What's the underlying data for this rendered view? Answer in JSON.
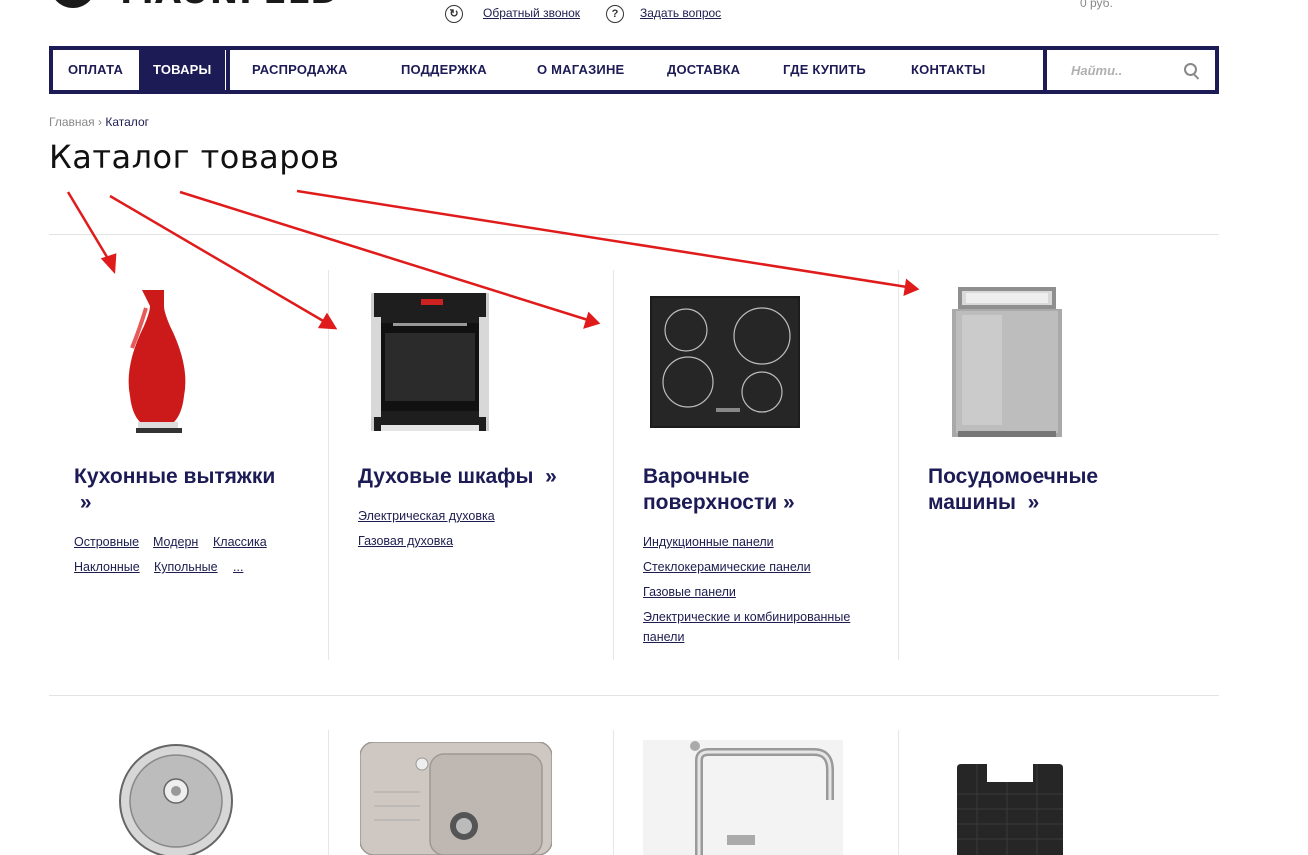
{
  "header": {
    "callback_label": "Обратный звонок",
    "ask_label": "Задать вопрос",
    "cart_total": "0 руб."
  },
  "nav": {
    "items": [
      "ОПЛАТА",
      "ТОВАРЫ",
      "РАСПРОДАЖА",
      "ПОДДЕРЖКА",
      "О МАГАЗИНЕ",
      "ДОСТАВКА",
      "ГДЕ КУПИТЬ",
      "КОНТАКТЫ"
    ],
    "active": "ТОВАРЫ",
    "search_placeholder": "Найти.."
  },
  "breadcrumb": {
    "home": "Главная",
    "current": "Каталог"
  },
  "page_title": "Каталог товаров",
  "categories": [
    {
      "title": "Кухонные вытяжки",
      "links": [
        "Островные",
        "Модерн",
        "Классика",
        "Наклонные",
        "Купольные",
        "..."
      ]
    },
    {
      "title": "Духовые шкафы",
      "links": [
        "Электрическая духовка",
        "Газовая духовка"
      ]
    },
    {
      "title_line1": "Варочные",
      "title_line2": "поверхности",
      "links": [
        "Индукционные панели",
        "Стеклокерамические панели",
        "Газовые панели",
        "Электрические и комбинированные",
        "панели"
      ]
    },
    {
      "title_line1": "Посудомоечные",
      "title_line2": "машины"
    }
  ],
  "icons": {
    "callback": "refresh-icon",
    "ask": "question-icon",
    "search": "search-icon"
  },
  "colors": {
    "brand": "#1c1b55",
    "annotation_arrow": "#e01b1b"
  }
}
